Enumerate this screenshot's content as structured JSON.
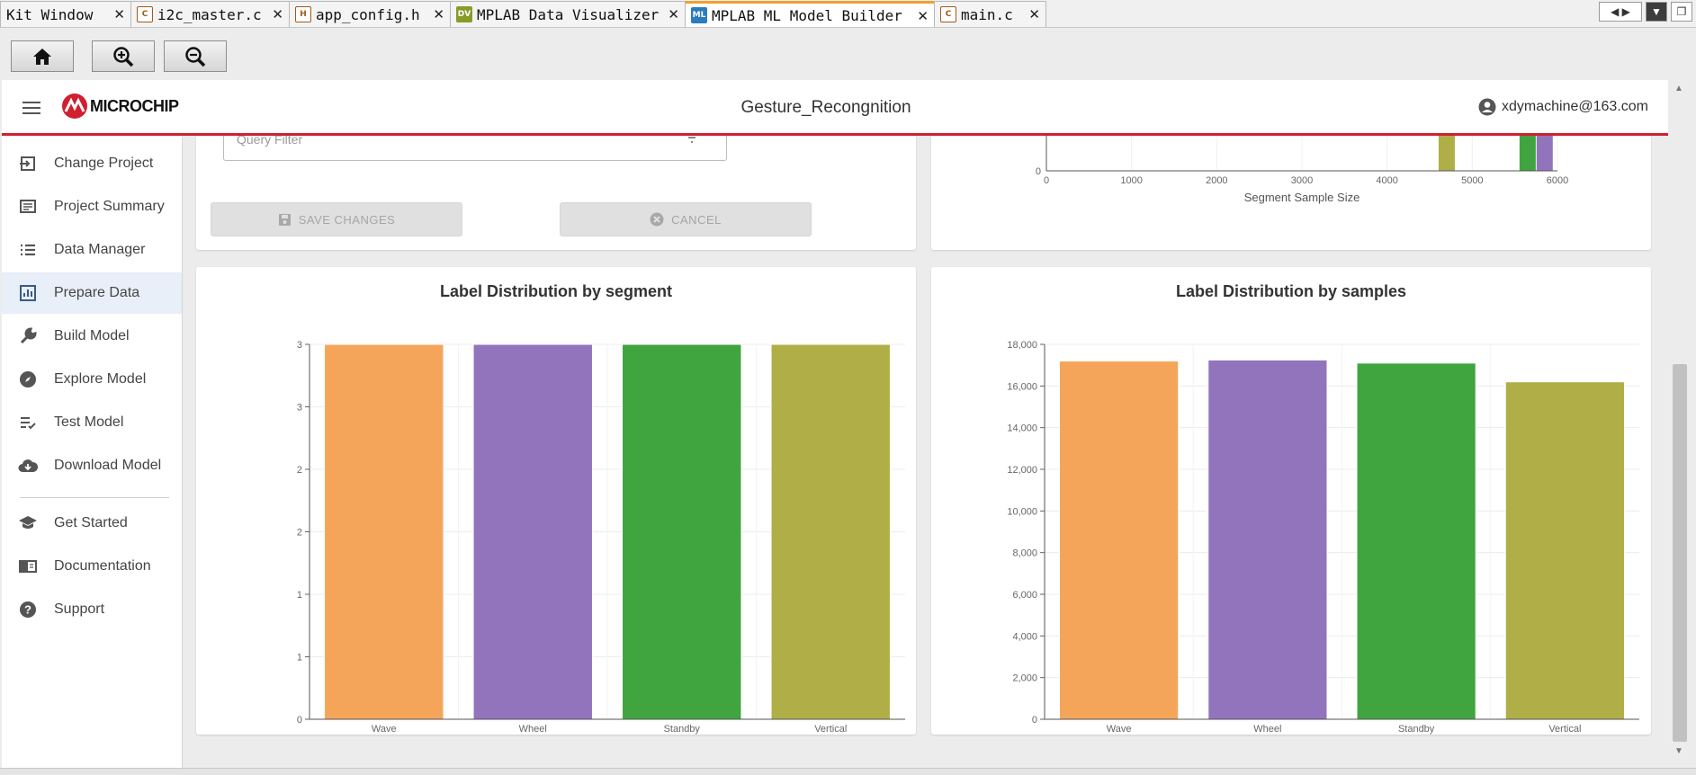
{
  "ide_tabs": [
    {
      "label": "Kit Window",
      "icon": "none"
    },
    {
      "label": "i2c_master.c",
      "icon": "c-file-icon"
    },
    {
      "label": "app_config.h",
      "icon": "header-file-icon"
    },
    {
      "label": "MPLAB Data Visualizer",
      "icon": "dv-icon",
      "icon_text": "DV"
    },
    {
      "label": "MPLAB ML Model Builder",
      "icon": "ml-icon",
      "icon_text": "ML",
      "active": true
    },
    {
      "label": "main.c",
      "icon": "c-file-icon"
    }
  ],
  "toolbar": {
    "home": "home-icon",
    "zoom_in": "zoom-in-icon",
    "zoom_out": "zoom-out-icon"
  },
  "header": {
    "brand": "MICROCHIP",
    "project_title": "Gesture_Recongnition",
    "user_email": "xdymachine@163.com"
  },
  "sidebar": {
    "items": [
      {
        "label": "Change Project",
        "icon": "enter-icon"
      },
      {
        "label": "Project Summary",
        "icon": "summary-icon"
      },
      {
        "label": "Data Manager",
        "icon": "list-icon"
      },
      {
        "label": "Prepare Data",
        "icon": "chart-icon",
        "active": true
      },
      {
        "label": "Build Model",
        "icon": "wrench-icon"
      },
      {
        "label": "Explore Model",
        "icon": "compass-icon"
      },
      {
        "label": "Test Model",
        "icon": "checklist-icon"
      },
      {
        "label": "Download Model",
        "icon": "cloud-download-icon"
      }
    ],
    "secondary": [
      {
        "label": "Get Started",
        "icon": "school-icon"
      },
      {
        "label": "Documentation",
        "icon": "book-icon"
      },
      {
        "label": "Support",
        "icon": "help-icon"
      }
    ]
  },
  "filter": {
    "placeholder": "Query Filter"
  },
  "buttons": {
    "save": "SAVE CHANGES",
    "cancel": "CANCEL"
  },
  "colors": {
    "wave": "#f5a55a",
    "wheel": "#9174bc",
    "standby": "#40a43f",
    "vertical": "#afae47",
    "accent_red": "#d02030"
  },
  "chart_data": [
    {
      "type": "bar",
      "title": "",
      "xlabel": "Segment Sample Size",
      "ylabel": "",
      "xlim": [
        0,
        6000
      ],
      "x_ticks": [
        "0",
        "1000",
        "2000",
        "3000",
        "4000",
        "5000",
        "6000"
      ],
      "y_ticks": [
        "0"
      ],
      "note": "partially scrolled out of view; only lower portion visible",
      "series": [
        {
          "color": "#afae47",
          "x": 4700
        },
        {
          "color": "#40a43f",
          "x": 5650
        },
        {
          "color": "#9174bc",
          "x": 5850
        }
      ]
    },
    {
      "type": "bar",
      "title": "Label Distribution by segment",
      "categories": [
        "Wave",
        "Wheel",
        "Standby",
        "Vertical"
      ],
      "values": [
        3,
        3,
        3,
        3
      ],
      "ylim": [
        0,
        3
      ],
      "y_ticks": [
        "0",
        "1",
        "1",
        "2",
        "2",
        "3",
        "3"
      ],
      "xlabel": "",
      "ylabel": ""
    },
    {
      "type": "bar",
      "title": "Label Distribution by samples",
      "categories": [
        "Wave",
        "Wheel",
        "Standby",
        "Vertical"
      ],
      "values": [
        17200,
        17250,
        17100,
        16200
      ],
      "ylim": [
        0,
        18000
      ],
      "y_ticks": [
        "0",
        "2,000",
        "4,000",
        "6,000",
        "8,000",
        "10,000",
        "12,000",
        "14,000",
        "16,000",
        "18,000"
      ],
      "xlabel": "",
      "ylabel": ""
    }
  ]
}
